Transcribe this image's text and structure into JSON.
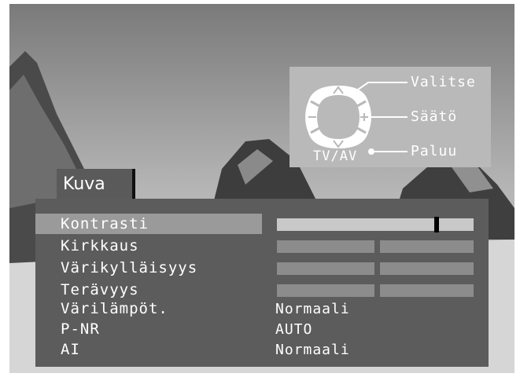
{
  "help_panel": {
    "select_label": "Valitse",
    "adjust_label": "Säätö",
    "return_label": "Paluu",
    "tvav_label": "TV/AV",
    "icons": [
      "up-arrow-icon",
      "down-arrow-icon",
      "minus-icon",
      "plus-icon",
      "remote-dial-icon"
    ]
  },
  "menu": {
    "title": "Kuva",
    "rows": [
      {
        "label": "Kontrasti",
        "type": "slider",
        "level": 0.8,
        "selected": true
      },
      {
        "label": "Kirkkaus",
        "type": "slider",
        "level": 0.5,
        "selected": false
      },
      {
        "label": "Värikylläisyys",
        "type": "slider",
        "level": 0.5,
        "selected": false
      },
      {
        "label": "Terävyys",
        "type": "slider",
        "level": 0.5,
        "selected": false
      },
      {
        "label": "Värilämpöt.",
        "type": "value",
        "value": "Normaali",
        "selected": false
      },
      {
        "label": "P-NR",
        "type": "value",
        "value": "AUTO",
        "selected": false
      },
      {
        "label": "AI",
        "type": "value",
        "value": "Normaali",
        "selected": false
      }
    ]
  },
  "colors": {
    "panel_bg": "#5c5c5c",
    "highlight": "#9a9a9a",
    "text": "#ffffff",
    "slider_track": "#c8c8c8",
    "slider_inactive": "#8c8c8c",
    "help_bg": "#b9b9b9"
  }
}
